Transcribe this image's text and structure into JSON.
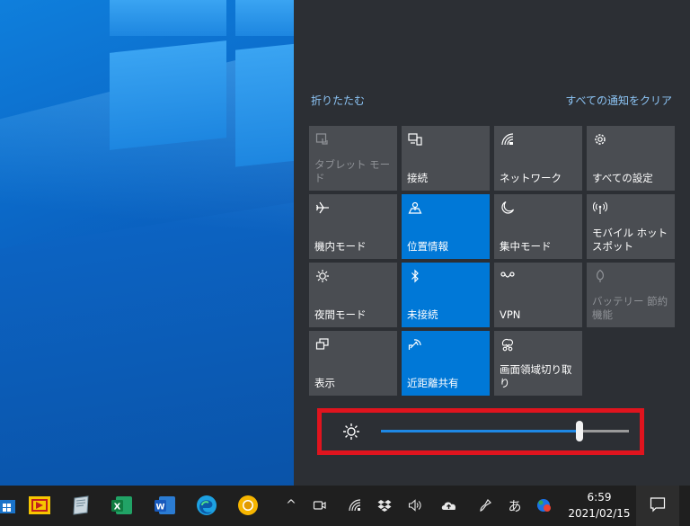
{
  "action_center": {
    "collapse_label": "折りたたむ",
    "clear_all_label": "すべての通知をクリア",
    "tiles": [
      {
        "label": "タブレット モード",
        "icon": "tablet-mode-icon",
        "state": "disabled"
      },
      {
        "label": "接続",
        "icon": "connect-icon",
        "state": "off"
      },
      {
        "label": "ネットワーク",
        "icon": "network-icon",
        "state": "off"
      },
      {
        "label": "すべての設定",
        "icon": "gear-icon",
        "state": "off"
      },
      {
        "label": "機内モード",
        "icon": "airplane-icon",
        "state": "off"
      },
      {
        "label": "位置情報",
        "icon": "location-icon",
        "state": "on"
      },
      {
        "label": "集中モード",
        "icon": "moon-icon",
        "state": "off"
      },
      {
        "label": "モバイル ホットスポット",
        "icon": "hotspot-icon",
        "state": "off"
      },
      {
        "label": "夜間モード",
        "icon": "night-light-icon",
        "state": "off"
      },
      {
        "label": "未接続",
        "icon": "bluetooth-icon",
        "state": "on"
      },
      {
        "label": "VPN",
        "icon": "vpn-icon",
        "state": "off"
      },
      {
        "label": "バッテリー 節約機能",
        "icon": "battery-saver-icon",
        "state": "disabled"
      },
      {
        "label": "表示",
        "icon": "project-icon",
        "state": "off"
      },
      {
        "label": "近距離共有",
        "icon": "nearby-share-icon",
        "state": "on"
      },
      {
        "label": "画面領域切り取り",
        "icon": "snip-icon",
        "state": "off"
      }
    ],
    "brightness": {
      "icon": "brightness-icon",
      "value": 0.8
    }
  },
  "taskbar": {
    "apps": [
      {
        "name": "store-app-icon"
      },
      {
        "name": "viewer-app-icon"
      },
      {
        "name": "notes-app-icon"
      },
      {
        "name": "excel-app-icon",
        "letter": "X"
      },
      {
        "name": "word-app-icon",
        "letter": "W"
      },
      {
        "name": "edge-app-icon"
      },
      {
        "name": "chrome-canary-app-icon"
      }
    ],
    "tray": {
      "show_hidden": "^",
      "ime": "あ"
    },
    "clock": {
      "time": "6:59",
      "date": "2021/02/15"
    }
  },
  "colors": {
    "accent": "#0078d7",
    "tile": "#4a4d52",
    "panel": "#2c2f34",
    "highlight_box": "#e0141e"
  }
}
